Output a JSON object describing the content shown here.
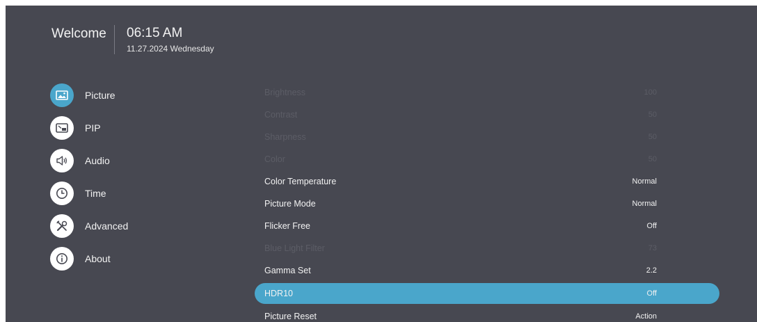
{
  "header": {
    "welcome": "Welcome",
    "time": "06:15 AM",
    "date": "11.27.2024 Wednesday"
  },
  "sidebar": {
    "items": [
      {
        "label": "Picture",
        "icon": "picture-icon",
        "active": true
      },
      {
        "label": "PIP",
        "icon": "pip-icon",
        "active": false
      },
      {
        "label": "Audio",
        "icon": "speaker-icon",
        "active": false
      },
      {
        "label": "Time",
        "icon": "clock-icon",
        "active": false
      },
      {
        "label": "Advanced",
        "icon": "tools-icon",
        "active": false
      },
      {
        "label": "About",
        "icon": "info-icon",
        "active": false
      }
    ]
  },
  "settings": {
    "rows": [
      {
        "label": "Brightness",
        "value": "100",
        "enabled": false
      },
      {
        "label": "Contrast",
        "value": "50",
        "enabled": false
      },
      {
        "label": "Sharpness",
        "value": "50",
        "enabled": false
      },
      {
        "label": "Color",
        "value": "50",
        "enabled": false
      },
      {
        "label": "Color Temperature",
        "value": "Normal",
        "enabled": true
      },
      {
        "label": "Picture Mode",
        "value": "Normal",
        "enabled": true
      },
      {
        "label": "Flicker Free",
        "value": "Off",
        "enabled": true
      },
      {
        "label": "Blue Light Filter",
        "value": "73",
        "enabled": false
      },
      {
        "label": "Gamma Set",
        "value": "2.2",
        "enabled": true
      },
      {
        "label": "HDR10",
        "value": "Off",
        "enabled": true,
        "selected": true
      },
      {
        "label": "Picture Reset",
        "value": "Action",
        "enabled": true
      }
    ]
  },
  "colors": {
    "background": "#474851",
    "accent": "#4aa6cb",
    "text": "#f2f2f2",
    "disabled_text": "#5c5d66"
  }
}
